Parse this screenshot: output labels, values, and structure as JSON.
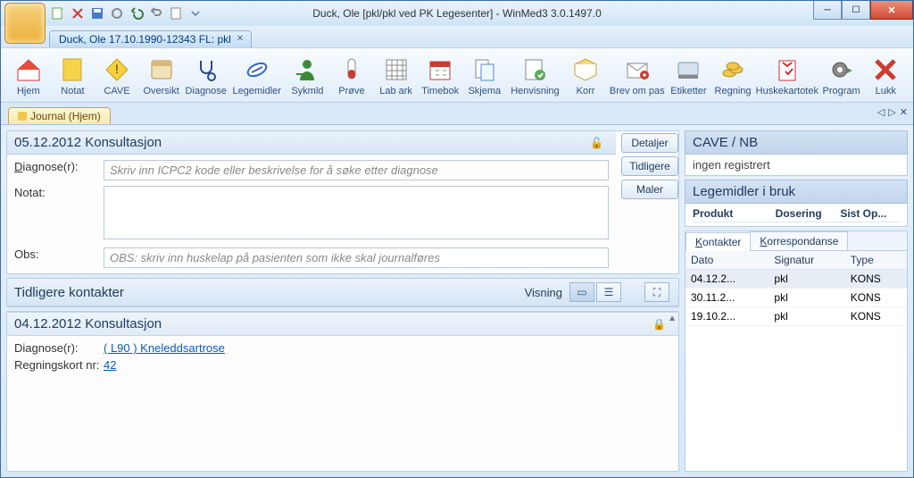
{
  "title": "Duck, Ole [pkl/pkl ved PK Legesenter] - WinMed3 3.0.1497.0",
  "patient_tab": "Duck, Ole 17.10.1990-12343 FL: pkl",
  "ribbon": [
    {
      "id": "hjem",
      "label": "Hjem"
    },
    {
      "id": "notat",
      "label": "Notat"
    },
    {
      "id": "cave",
      "label": "CAVE"
    },
    {
      "id": "oversikt",
      "label": "Oversikt"
    },
    {
      "id": "diagnose",
      "label": "Diagnose"
    },
    {
      "id": "legemidler",
      "label": "Legemidler"
    },
    {
      "id": "sykmld",
      "label": "Sykmld"
    },
    {
      "id": "prove",
      "label": "Prøve"
    },
    {
      "id": "labark",
      "label": "Lab ark"
    },
    {
      "id": "timebok",
      "label": "Timebok"
    },
    {
      "id": "skjema",
      "label": "Skjema"
    },
    {
      "id": "henvisning",
      "label": "Henvisning"
    },
    {
      "id": "korr",
      "label": "Korr"
    },
    {
      "id": "brevompas",
      "label": "Brev om pas"
    },
    {
      "id": "etiketter",
      "label": "Etiketter"
    },
    {
      "id": "regning",
      "label": "Regning"
    },
    {
      "id": "huskekartotek",
      "label": "Huskekartotek"
    },
    {
      "id": "program",
      "label": "Program"
    },
    {
      "id": "lukk",
      "label": "Lukk"
    }
  ],
  "journal_tab": "Journal (Hjem)",
  "current": {
    "header": "05.12.2012 Konsultasjon",
    "diag_label": "Diagnose(r):",
    "diag_placeholder": "Skriv inn ICPC2 kode eller beskrivelse for å søke etter diagnose",
    "notat_label": "Notat:",
    "obs_label": "Obs:",
    "obs_placeholder": "OBS: skriv inn huskelap på pasienten som ikke skal journalføres",
    "btn_detaljer": "Detaljer",
    "btn_tidligere": "Tidligere",
    "btn_maler": "Maler"
  },
  "tk_header": "Tidligere kontakter",
  "tk_visning": "Visning",
  "prev_entry": {
    "header": "04.12.2012 Konsultasjon",
    "diag_label": "Diagnose(r):",
    "diag_value": "( L90 ) Kneleddsartrose",
    "regn_label": "Regningskort nr:",
    "regn_value": "42"
  },
  "right": {
    "cave_header": "CAVE / NB",
    "cave_text": "ingen registrert",
    "lib_header": "Legemidler i bruk",
    "lib_cols": {
      "c1": "Produkt",
      "c2": "Dosering",
      "c3": "Sist Op..."
    },
    "tab_kontakter": "Kontakter",
    "tab_korr": "Korrespondanse",
    "table_cols": {
      "c1": "Dato",
      "c2": "Signatur",
      "c3": "Type"
    },
    "rows": [
      {
        "d": "04.12.2...",
        "s": "pkl",
        "t": "KONS"
      },
      {
        "d": "30.11.2...",
        "s": "pkl",
        "t": "KONS"
      },
      {
        "d": "19.10.2...",
        "s": "pkl",
        "t": "KONS"
      }
    ]
  }
}
